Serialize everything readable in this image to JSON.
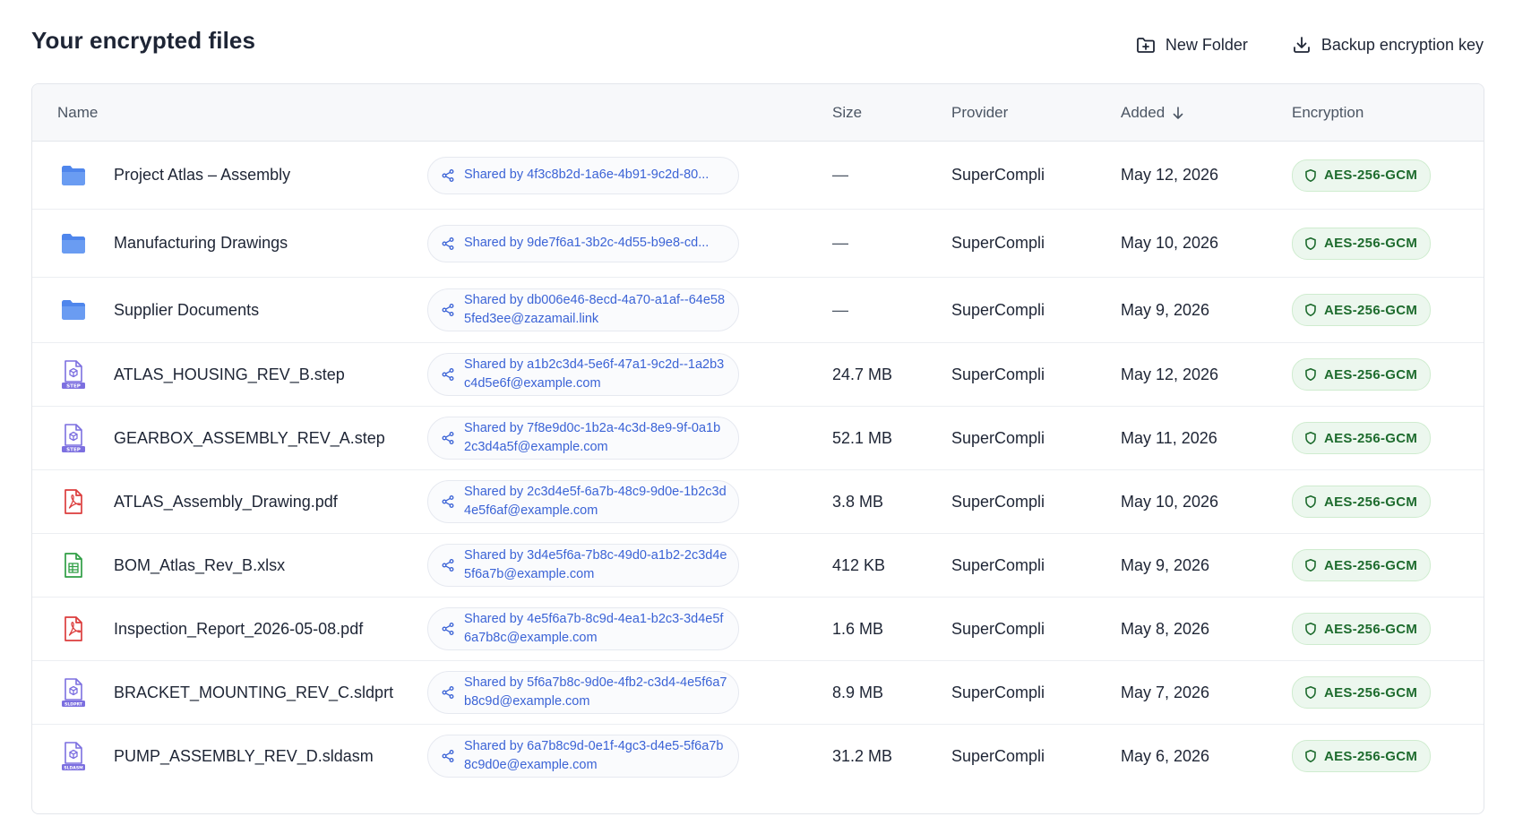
{
  "page_title": "Your encrypted files",
  "actions": {
    "new_folder": "New Folder",
    "backup_key": "Backup encryption key"
  },
  "columns": {
    "name": "Name",
    "size": "Size",
    "provider": "Provider",
    "added": "Added",
    "encryption": "Encryption"
  },
  "colors": {
    "folder": "#5b8def",
    "step": "#7c6fe0",
    "pdf": "#dc3d3d",
    "xlsx": "#2f9e44",
    "link": "#3b63d6",
    "badge_text": "#1d6b2d"
  },
  "rows": [
    {
      "icon": "folder-icon",
      "name": "Project Atlas – Assembly",
      "shared": "Shared by 4f3c8b2d-1a6e-4b91-9c2d-80...",
      "size": "—",
      "provider": "SuperCompli",
      "added": "May 12, 2026",
      "encryption": "AES-256-GCM"
    },
    {
      "icon": "folder-icon",
      "name": "Manufacturing Drawings",
      "shared": "Shared by 9de7f6a1-3b2c-4d55-b9e8-cd...",
      "size": "—",
      "provider": "SuperCompli",
      "added": "May 10, 2026",
      "encryption": "AES-256-GCM"
    },
    {
      "icon": "folder-icon",
      "name": "Supplier Documents",
      "shared": "Shared by db006e46-8ecd-4a70-a1af--64e585fed3ee@zazamail.link",
      "size": "—",
      "provider": "SuperCompli",
      "added": "May 9, 2026",
      "encryption": "AES-256-GCM"
    },
    {
      "icon": "step-file-icon",
      "name": "ATLAS_HOUSING_REV_B.step",
      "shared": "Shared by a1b2c3d4-5e6f-47a1-9c2d--1a2b3c4d5e6f@example.com",
      "size": "24.7 MB",
      "provider": "SuperCompli",
      "added": "May 12, 2026",
      "encryption": "AES-256-GCM",
      "badge": "STEP"
    },
    {
      "icon": "step-file-icon",
      "name": "GEARBOX_ASSEMBLY_REV_A.step",
      "shared": "Shared by 7f8e9d0c-1b2a-4c3d-8e9-9f-0a1b2c3d4a5f@example.com",
      "size": "52.1 MB",
      "provider": "SuperCompli",
      "added": "May 11, 2026",
      "encryption": "AES-256-GCM",
      "badge": "STEP"
    },
    {
      "icon": "pdf-file-icon",
      "name": "ATLAS_Assembly_Drawing.pdf",
      "shared": "Shared by 2c3d4e5f-6a7b-48c9-9d0e-1b2c3d4e5f6af@example.com",
      "size": "3.8 MB",
      "provider": "SuperCompli",
      "added": "May 10, 2026",
      "encryption": "AES-256-GCM"
    },
    {
      "icon": "spreadsheet-file-icon",
      "name": "BOM_Atlas_Rev_B.xlsx",
      "shared": "Shared by 3d4e5f6a-7b8c-49d0-a1b2-2c3d4e5f6a7b@example.com",
      "size": "412 KB",
      "provider": "SuperCompli",
      "added": "May 9, 2026",
      "encryption": "AES-256-GCM"
    },
    {
      "icon": "pdf-file-icon",
      "name": "Inspection_Report_2026-05-08.pdf",
      "shared": "Shared by 4e5f6a7b-8c9d-4ea1-b2c3-3d4e5f6a7b8c@example.com",
      "size": "1.6 MB",
      "provider": "SuperCompli",
      "added": "May 8, 2026",
      "encryption": "AES-256-GCM"
    },
    {
      "icon": "sldprt-file-icon",
      "name": "BRACKET_MOUNTING_REV_C.sldprt",
      "shared": "Shared by 5f6a7b8c-9d0e-4fb2-c3d4-4e5f6a7b8c9d@example.com",
      "size": "8.9 MB",
      "provider": "SuperCompli",
      "added": "May 7, 2026",
      "encryption": "AES-256-GCM",
      "badge": "SLDPRT"
    },
    {
      "icon": "sldasm-file-icon",
      "name": "PUMP_ASSEMBLY_REV_D.sldasm",
      "shared": "Shared by 6a7b8c9d-0e1f-4gc3-d4e5-5f6a7b8c9d0e@example.com",
      "size": "31.2 MB",
      "provider": "SuperCompli",
      "added": "May 6, 2026",
      "encryption": "AES-256-GCM",
      "badge": "SLDASM"
    }
  ]
}
